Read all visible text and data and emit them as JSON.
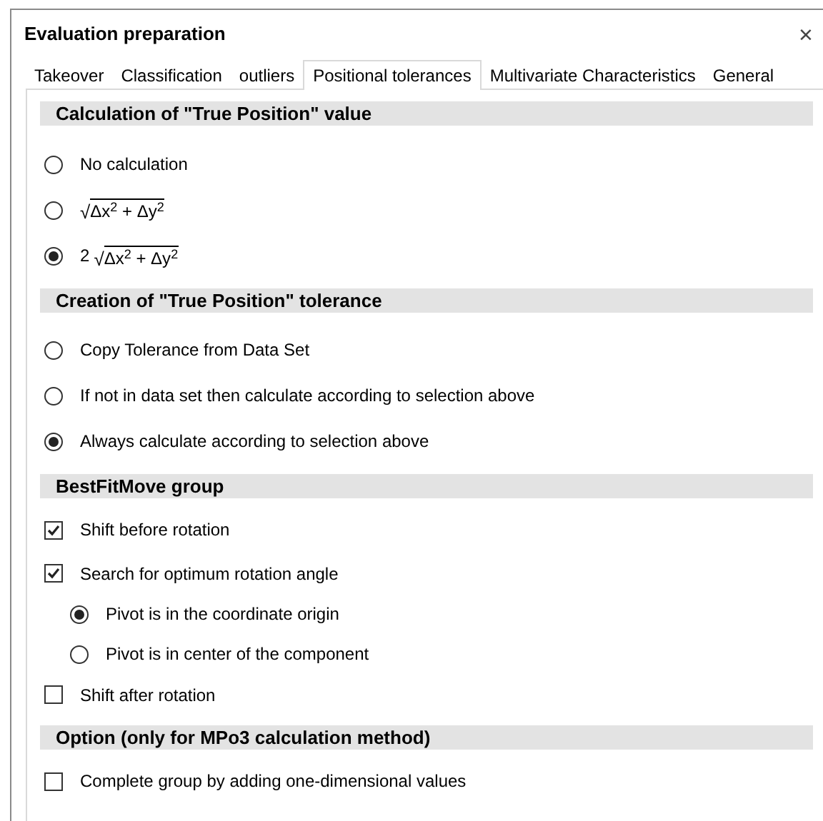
{
  "window": {
    "title": "Evaluation preparation",
    "close": "×"
  },
  "tabs": [
    {
      "label": "Takeover",
      "selected": false
    },
    {
      "label": "Classification",
      "selected": false
    },
    {
      "label": "outliers",
      "selected": false
    },
    {
      "label": "Positional tolerances",
      "selected": true
    },
    {
      "label": "Multivariate Characteristics",
      "selected": false
    },
    {
      "label": "General",
      "selected": false
    }
  ],
  "sections": [
    {
      "title": "Calculation of \"True Position\" value",
      "items": [
        {
          "kind": "radio",
          "label": "No calculation",
          "selected": false
        },
        {
          "kind": "formula",
          "radical": "√",
          "radicand": "Δx$^{2}$ + Δy$^{2}$",
          "selected": false
        },
        {
          "kind": "formula",
          "factor": "2",
          "radical": "√",
          "radicand": "Δx$^{2}$ + Δy$^{2}$",
          "selected": true
        }
      ]
    },
    {
      "title": "Creation of \"True Position\" tolerance",
      "items": [
        {
          "kind": "radio",
          "label": "Copy Tolerance from Data Set",
          "selected": false
        },
        {
          "kind": "radio",
          "label": "If not in data set then calculate according to selection above",
          "selected": false
        },
        {
          "kind": "radio",
          "label": "Always calculate according to selection above",
          "selected": true
        }
      ]
    },
    {
      "title": "BestFitMove group",
      "items": [
        {
          "kind": "checkbox",
          "label": "Shift before rotation",
          "checked": true
        },
        {
          "kind": "checkbox",
          "label": "Search for optimum rotation angle",
          "checked": true,
          "children": [
            {
              "kind": "radio",
              "label": "Pivot is in the coordinate origin",
              "selected": true
            },
            {
              "kind": "radio",
              "label": "Pivot is in center of the component",
              "selected": false
            }
          ]
        },
        {
          "kind": "checkbox",
          "label": "Shift after rotation",
          "checked": false
        }
      ]
    },
    {
      "title": "Option (only for MPo3 calculation method)",
      "items": [
        {
          "kind": "checkbox",
          "label": "Complete group by adding one-dimensional values",
          "checked": false
        }
      ]
    }
  ]
}
